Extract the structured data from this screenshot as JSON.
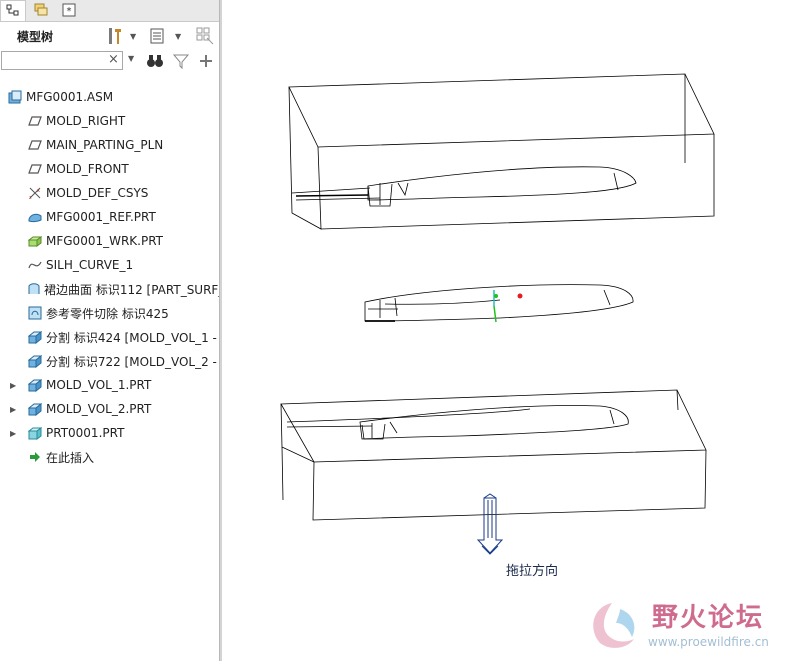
{
  "tabs": [
    {
      "name": "model-tree-tab-icon"
    },
    {
      "name": "layer-tree-tab-icon"
    },
    {
      "name": "favorites-tab-icon"
    }
  ],
  "header": {
    "title": "模型树"
  },
  "search": {
    "value": "",
    "clear": "×"
  },
  "tree": {
    "items": [
      {
        "label": "MFG0001.ASM",
        "icon": "assembly-icon"
      },
      {
        "label": "MOLD_RIGHT",
        "icon": "datum-plane-icon"
      },
      {
        "label": "MAIN_PARTING_PLN",
        "icon": "datum-plane-icon"
      },
      {
        "label": "MOLD_FRONT",
        "icon": "datum-plane-icon"
      },
      {
        "label": "MOLD_DEF_CSYS",
        "icon": "csys-icon"
      },
      {
        "label": "MFG0001_REF.PRT",
        "icon": "ref-part-icon"
      },
      {
        "label": "MFG0001_WRK.PRT",
        "icon": "workpiece-icon"
      },
      {
        "label": "SILH_CURVE_1",
        "icon": "curve-icon"
      },
      {
        "label": "裙边曲面 标识112 [PART_SURF_",
        "icon": "surface-icon"
      },
      {
        "label": "参考零件切除 标识425",
        "icon": "cutout-icon"
      },
      {
        "label": "分割 标识424 [MOLD_VOL_1 -",
        "icon": "split-icon"
      },
      {
        "label": "分割 标识722 [MOLD_VOL_2 -",
        "icon": "split-icon"
      },
      {
        "label": "MOLD_VOL_1.PRT",
        "icon": "volume-icon",
        "expandable": true
      },
      {
        "label": "MOLD_VOL_2.PRT",
        "icon": "volume-icon",
        "expandable": true
      },
      {
        "label": "PRT0001.PRT",
        "icon": "part-icon",
        "expandable": true
      },
      {
        "label": "在此插入",
        "icon": "insert-here-icon"
      }
    ]
  },
  "viewport": {
    "pull_direction": "拖拉方向"
  },
  "watermark": {
    "cn": "野火论坛",
    "url": "www.proewildfire.cn"
  },
  "colors": {
    "accent": "#2b6cb0",
    "line": "#000000",
    "arrow": "#1a3a8a",
    "watermark": "#c03a6a"
  }
}
